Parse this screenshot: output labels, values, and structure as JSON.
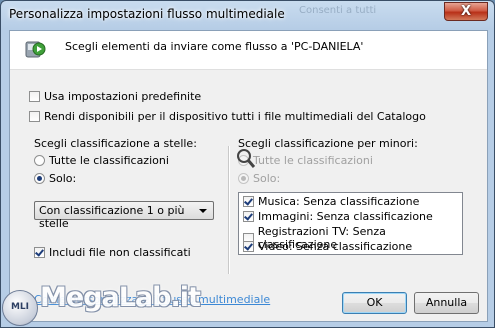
{
  "window": {
    "title": "Personalizza impostazioni flusso multimediale",
    "ghost_text": "Consenti a tutti",
    "close_label": "X"
  },
  "header": {
    "text": "Scegli elementi da inviare come flusso a 'PC-DANIELA'",
    "icon": "media-stream-icon"
  },
  "options": {
    "use_defaults": {
      "label": "Usa impostazioni predefinite",
      "checked": false
    },
    "make_available": {
      "label": "Rendi disponibili per il dispositivo tutti i file multimediali del Catalogo",
      "checked": false
    }
  },
  "star_rating": {
    "heading": "Scegli classificazione a stelle:",
    "all_label": "Tutte le classificazioni",
    "only_label": "Solo:",
    "selected": "only",
    "dropdown_value": "Con classificazione 1 o più stelle",
    "include_unrated": {
      "label": "Includi file non classificati",
      "checked": true
    }
  },
  "parental": {
    "heading": "Scegli classificazione per minori:",
    "all_label": "Tutte le classificazioni",
    "only_label": "Solo:",
    "selected": "only",
    "items": [
      {
        "label": "Musica: Senza classificazione",
        "checked": true
      },
      {
        "label": "Immagini: Senza classificazione",
        "checked": true
      },
      {
        "label": "Registrazioni TV: Senza classificazione",
        "checked": false
      },
      {
        "label": "Video: Senza classificazione",
        "checked": true
      }
    ]
  },
  "footer": {
    "link": "Come personalizzare il flusso multimediale",
    "ok_label": "OK",
    "cancel_label": "Annulla"
  },
  "watermark": {
    "text": "MegaLab.it",
    "badge": "MLI"
  },
  "colors": {
    "title_bar": "#b6cde6",
    "close_button": "#c44a33",
    "link": "#0066cc"
  }
}
